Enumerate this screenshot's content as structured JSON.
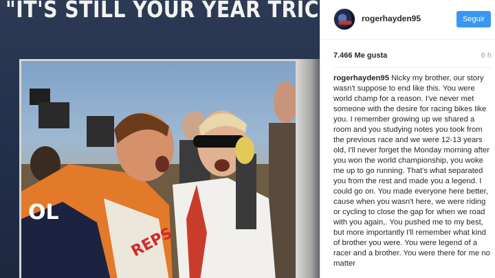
{
  "photo": {
    "headline": "\"IT'S STILL YOUR YEAR TRICK\"",
    "livery_text_1": "OL",
    "livery_text_2": "REPS"
  },
  "post": {
    "username": "rogerhayden95",
    "follow_label": "Seguir",
    "likes": "7.466 Me gusta",
    "time": "6 h",
    "caption_user": "rogerhayden95",
    "caption_text": "Nicky my brother, our story wasn't suppose to end like this. You were world champ for a reason. I've never met someone with the desire for racing bikes like you. I remember growing up we shared a room and you studying notes you took from the previous race and we were 12-13 years old, I'll never forget the Monday morning after you won the world championship, you woke me up to go running. That's what separated you from the rest and made you a legend. I could go on. You made everyone here better, cause when you wasn't here, we were riding or cycling to close the gap for when we road with you again,. You pushed me to my best, but more importantly I'll remember what kind of brother you were. You were legend of a racer and a brother. You were there for me no matter"
  },
  "colors": {
    "follow_button": "#3897f0",
    "text": "#262626",
    "muted": "#999999"
  }
}
